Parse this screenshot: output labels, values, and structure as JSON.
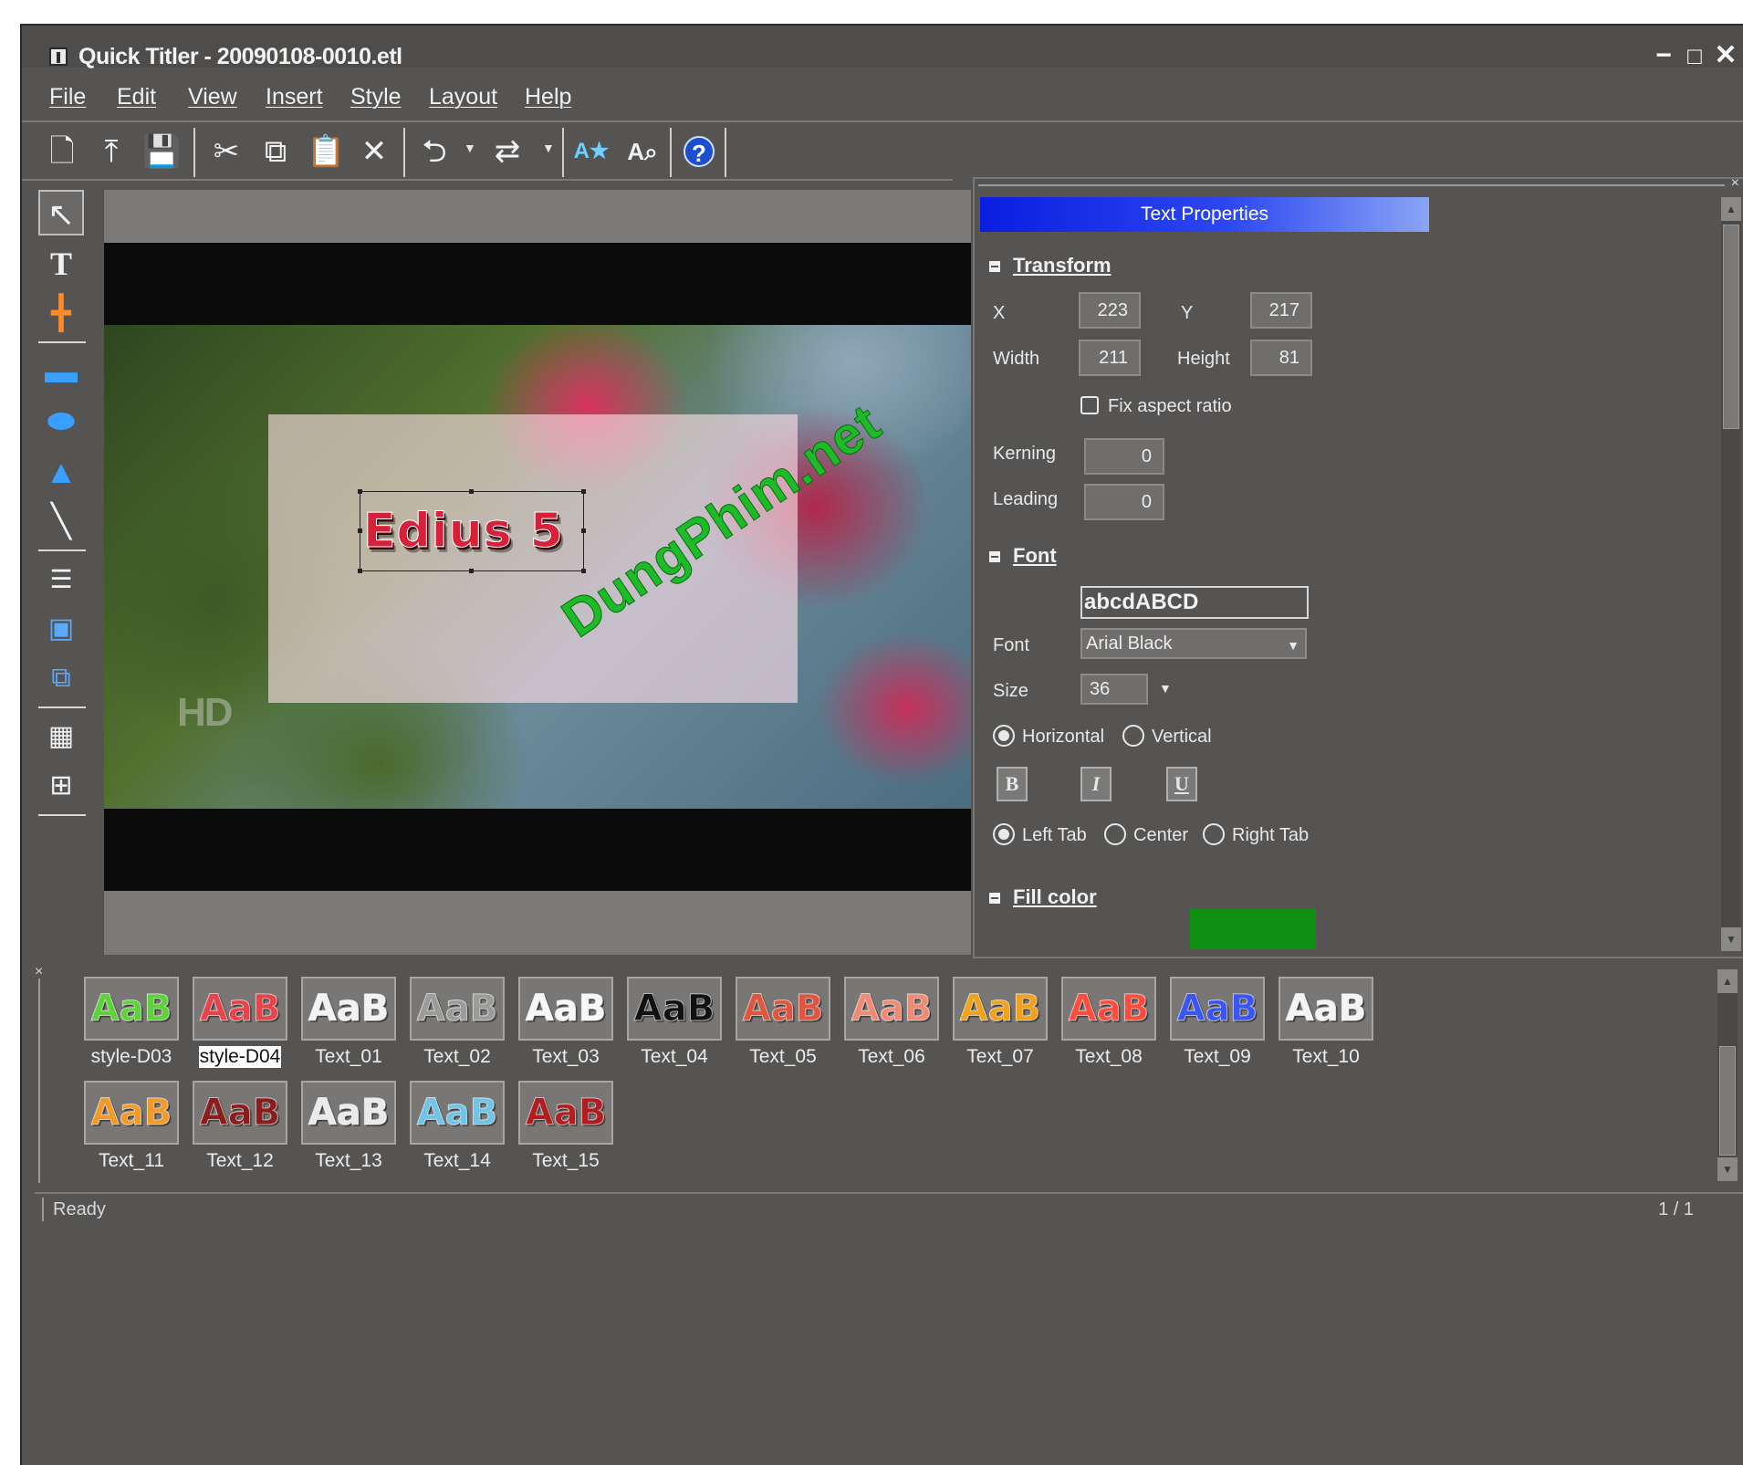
{
  "window": {
    "title": "Quick Titler - 20090108-0010.etl",
    "minimize": "−",
    "maximize": "□",
    "close": "✕"
  },
  "menu": [
    "File",
    "Edit",
    "View",
    "Insert",
    "Style",
    "Layout",
    "Help"
  ],
  "toolbar": {
    "icons": [
      "new-icon",
      "open-icon",
      "save-icon",
      "cut-icon",
      "copy-icon",
      "paste-icon",
      "delete-icon",
      "undo-icon",
      "redo-icon",
      "style-icon",
      "font-preview-icon",
      "help-icon"
    ],
    "glyphs": {
      "new": "🗋",
      "open": "⤒",
      "save": "💾",
      "cut": "✂",
      "copy": "⧉",
      "paste": "📋",
      "delete": "✕",
      "undo": "⮌",
      "redo": "⇄",
      "style": "A★",
      "font_preview": "A⌕",
      "help": "?"
    }
  },
  "palette": {
    "tools": [
      "select-tool-icon",
      "text-tool-icon",
      "image-tool-icon",
      "rectangle-tool-icon",
      "ellipse-tool-icon",
      "triangle-tool-icon",
      "line-tool-icon",
      "align-tool-icon",
      "center-tool-icon",
      "arrange-tool-icon",
      "grid-tool-icon",
      "safe-area-tool-icon"
    ],
    "glyphs": {
      "select": "↖",
      "text": "T",
      "image": "╋",
      "rectangle": "▬",
      "ellipse": "⬬",
      "triangle": "▲",
      "line": "╲",
      "align": "☰",
      "center": "▣",
      "arrange": "⧉",
      "grid": "▦",
      "safe_area": "⊞"
    }
  },
  "canvas": {
    "title_text": "Edius 5",
    "hd_logo": "HD",
    "watermark": "DungPhim.net"
  },
  "properties": {
    "header": "Text Properties",
    "transform": {
      "section": "Transform",
      "x_label": "X",
      "x": "223",
      "y_label": "Y",
      "y": "217",
      "width_label": "Width",
      "width": "211",
      "height_label": "Height",
      "height": "81",
      "fix_aspect_label": "Fix aspect ratio",
      "kerning_label": "Kerning",
      "kerning": "0",
      "leading_label": "Leading",
      "leading": "0"
    },
    "font": {
      "section": "Font",
      "sample": "abcdABCD",
      "font_label": "Font",
      "font_value": "Arial Black",
      "size_label": "Size",
      "size_value": "36",
      "horizontal_label": "Horizontal",
      "vertical_label": "Vertical",
      "bold_label": "B",
      "italic_label": "I",
      "underline_label": "U",
      "left_tab_label": "Left Tab",
      "center_label": "Center",
      "right_tab_label": "Right Tab"
    },
    "fill": {
      "section": "Fill color",
      "color": "#0f8f12"
    }
  },
  "gallery": {
    "close": "×",
    "items": [
      {
        "label": "style-D03",
        "sample": "AaB",
        "color": "#5fd13a"
      },
      {
        "label": "style-D04",
        "sample": "AaB",
        "color": "#e8434b"
      },
      {
        "label": "Text_01",
        "sample": "AaB",
        "color": "#f2f2f2"
      },
      {
        "label": "Text_02",
        "sample": "AaB",
        "color": "#9c9b9a"
      },
      {
        "label": "Text_03",
        "sample": "AaB",
        "color": "#f7f7f7"
      },
      {
        "label": "Text_04",
        "sample": "AaB",
        "color": "#111111"
      },
      {
        "label": "Text_05",
        "sample": "AaB",
        "color": "#e0553f"
      },
      {
        "label": "Text_06",
        "sample": "AaB",
        "color": "#f08a74"
      },
      {
        "label": "Text_07",
        "sample": "AaB",
        "color": "#f0a21c"
      },
      {
        "label": "Text_08",
        "sample": "AaB",
        "color": "#ff4d3d"
      },
      {
        "label": "Text_09",
        "sample": "AaB",
        "color": "#3a55f0"
      },
      {
        "label": "Text_10",
        "sample": "AaB",
        "color": "#f4f4f4"
      },
      {
        "label": "Text_11",
        "sample": "AaB",
        "color": "#f09a2a"
      },
      {
        "label": "Text_12",
        "sample": "AaB",
        "color": "#8a1d1d"
      },
      {
        "label": "Text_13",
        "sample": "AaB",
        "color": "#eaeaea"
      },
      {
        "label": "Text_14",
        "sample": "AaB",
        "color": "#6fc4e8"
      },
      {
        "label": "Text_15",
        "sample": "AaB",
        "color": "#b01d22"
      }
    ],
    "selected": "style-D04"
  },
  "status": {
    "text": "Ready",
    "page": "1 / 1"
  }
}
